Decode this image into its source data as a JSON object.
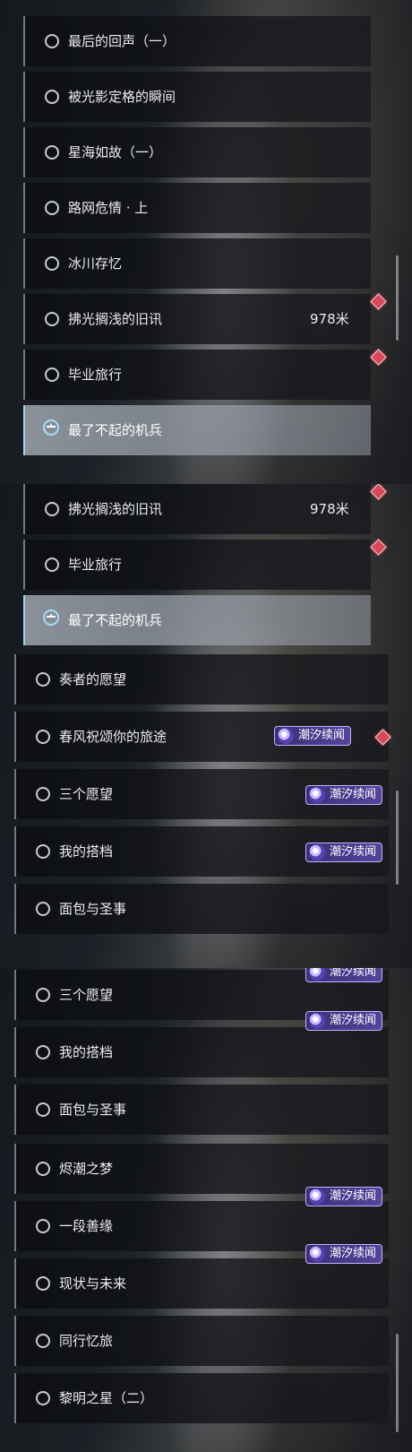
{
  "panel1": {
    "items": [
      {
        "label": "最后的回声（一）"
      },
      {
        "label": "被光影定格的瞬间"
      },
      {
        "label": "星海如故（一）"
      },
      {
        "label": "路网危情 · 上"
      },
      {
        "label": "冰川存忆"
      },
      {
        "label": "拂光搁浅的旧讯",
        "distance": "978米"
      },
      {
        "label": "毕业旅行"
      },
      {
        "label": "最了不起的机兵",
        "active": true
      }
    ]
  },
  "panel2": {
    "items": [
      {
        "label": "拂光搁浅的旧讯",
        "distance": "978米"
      },
      {
        "label": "毕业旅行"
      },
      {
        "label": "最了不起的机兵",
        "active": true
      },
      {
        "label": "奏者的愿望"
      },
      {
        "label": "春风祝颂你的旅途"
      },
      {
        "label": "三个愿望"
      },
      {
        "label": "我的搭档"
      },
      {
        "label": "面包与圣事"
      }
    ]
  },
  "panel3": {
    "items": [
      {
        "label": "三个愿望"
      },
      {
        "label": "我的搭档"
      },
      {
        "label": "面包与圣事"
      },
      {
        "label": "烬潮之梦"
      },
      {
        "label": "一段善缘"
      },
      {
        "label": "现状与未来"
      },
      {
        "label": "同行忆旅"
      },
      {
        "label": "黎明之星（二）"
      }
    ]
  },
  "badge_label": "潮汐续闻",
  "colors": {
    "accent": "#9fd6f0",
    "badge": "#56449b",
    "marker": "#d9485a"
  },
  "icons": [
    "ring-icon",
    "compass-icon",
    "diamond-marker-icon",
    "tide-event-icon"
  ]
}
